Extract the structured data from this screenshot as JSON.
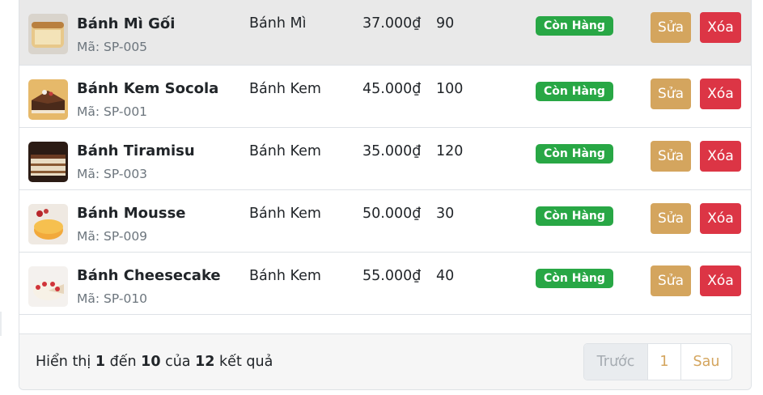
{
  "products": [
    {
      "name": "Bánh Mì Gối",
      "code": "Mã: SP-005",
      "category": "Bánh Mì",
      "price": "37.000₫",
      "quantity": "90",
      "status": "Còn Hàng",
      "edit_label": "Sửa",
      "delete_label": "Xóa"
    },
    {
      "name": "Bánh Kem Socola",
      "code": "Mã: SP-001",
      "category": "Bánh Kem",
      "price": "45.000₫",
      "quantity": "100",
      "status": "Còn Hàng",
      "edit_label": "Sửa",
      "delete_label": "Xóa"
    },
    {
      "name": "Bánh Tiramisu",
      "code": "Mã: SP-003",
      "category": "Bánh Kem",
      "price": "35.000₫",
      "quantity": "120",
      "status": "Còn Hàng",
      "edit_label": "Sửa",
      "delete_label": "Xóa"
    },
    {
      "name": "Bánh Mousse",
      "code": "Mã: SP-009",
      "category": "Bánh Kem",
      "price": "50.000₫",
      "quantity": "30",
      "status": "Còn Hàng",
      "edit_label": "Sửa",
      "delete_label": "Xóa"
    },
    {
      "name": "Bánh Cheesecake",
      "code": "Mã: SP-010",
      "category": "Bánh Kem",
      "price": "55.000₫",
      "quantity": "40",
      "status": "Còn Hàng",
      "edit_label": "Sửa",
      "delete_label": "Xóa"
    }
  ],
  "footer": {
    "info_prefix": "Hiển thị",
    "from": "1",
    "to_word": "đến",
    "to": "10",
    "of_word": "của",
    "total": "12",
    "suffix": "kết quả"
  },
  "pagination": {
    "prev": "Trước",
    "page": "1",
    "next": "Sau"
  },
  "colors": {
    "edit": "#d4a55e",
    "delete": "#dc3545",
    "status": "#28a745",
    "hover_row": "#e9e9e9"
  }
}
